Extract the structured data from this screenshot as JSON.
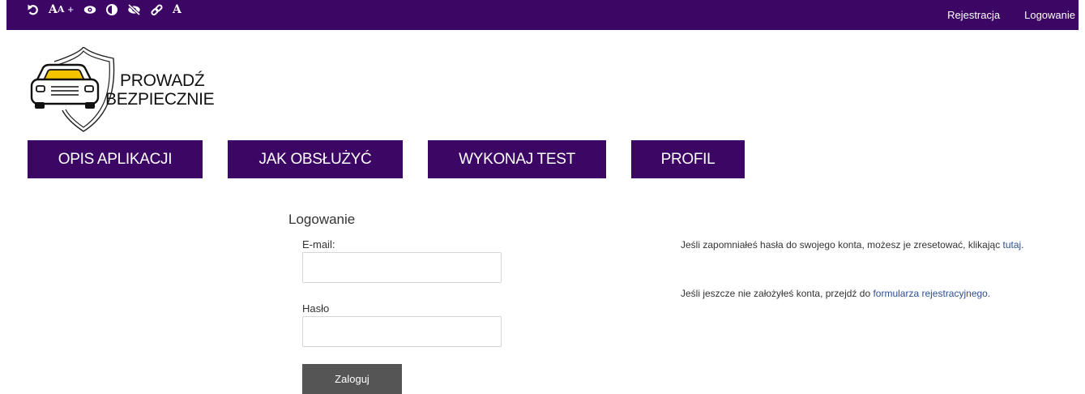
{
  "topbar": {
    "accessibility": {
      "icons": [
        "reset-icon",
        "font-size-icon",
        "eye-icon",
        "contrast-icon",
        "eye-slash-icon",
        "link-icon",
        "font-icon"
      ],
      "fontsize_big": "A",
      "fontsize_small": "A",
      "fontsize_plus": "+",
      "font_letter": "A"
    },
    "links": {
      "register": "Rejestracja",
      "login": "Logowanie"
    }
  },
  "logo": {
    "line1": "PROWADŹ",
    "line2": "BEZPIECZNIE"
  },
  "nav": {
    "items": [
      {
        "label": "OPIS APLIKACJI"
      },
      {
        "label": "JAK OBSŁUŻYĆ"
      },
      {
        "label": "WYKONAJ TEST"
      },
      {
        "label": "PROFIL"
      }
    ]
  },
  "login": {
    "title": "Logowanie",
    "email_label": "E-mail:",
    "email_value": "",
    "password_label": "Hasło",
    "password_value": "",
    "submit_label": "Zaloguj"
  },
  "info": {
    "reset_text": "Jeśli zapomniałeś hasła do swojego konta, możesz je zresetować, klikając ",
    "reset_link": "tutaj",
    "reset_end": ".",
    "register_text": "Jeśli jeszcze nie założyłeś konta, przejdź do ",
    "register_link": "formularza rejestracyjnego",
    "register_end": "."
  },
  "colors": {
    "brand_purple": "#3b0664",
    "button_gray": "#555555",
    "link_blue": "#2f4f91",
    "logo_car_window": "#f5c400"
  }
}
